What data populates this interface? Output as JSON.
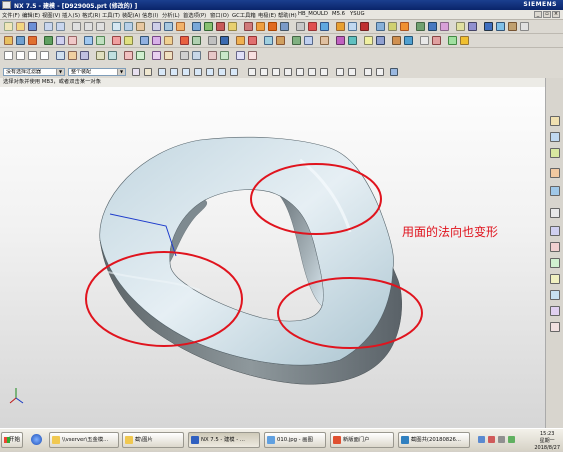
{
  "window": {
    "title": "NX 7.5 - 建模 - [D929005.prt  (修改的) ]",
    "brand": "SIEMENS"
  },
  "menu": {
    "items": [
      "文件(F)",
      "编辑(E)",
      "视图(V)",
      "插入(S)",
      "格式(R)",
      "工具(T)",
      "装配(A)",
      "信息(I)",
      "分析(L)",
      "首选项(P)",
      "窗口(O)",
      "GC工具箱",
      "电极(E)",
      "帮助(H)",
      "HB_MOULD",
      "M5.6",
      "YSUG"
    ]
  },
  "filterbar": {
    "type_filter": "没有选择过滤器",
    "scope_filter": "整个装配"
  },
  "cue_line": "选择对象并使用 MB3，或者双击某一对象",
  "annotation": "用面的法向也变形",
  "colors": {
    "annotation_red": "#e0141e",
    "model_face": "#b8d2dc",
    "model_side": "#6a747a",
    "titlebar": "#0a246a"
  },
  "taskbar": {
    "start_label": "开始",
    "tasks": [
      {
        "label": "\\\\vserver\\五金模..."
      },
      {
        "label": "截\\图片"
      },
      {
        "label": "NX 7.5 - 建模 - ..."
      },
      {
        "label": "010.jpg - 画图"
      },
      {
        "label": "新版面门户"
      },
      {
        "label": "截图共(20180826..."
      }
    ],
    "time": "15:23",
    "weekday": "星期一",
    "date": "2018/8/27"
  }
}
